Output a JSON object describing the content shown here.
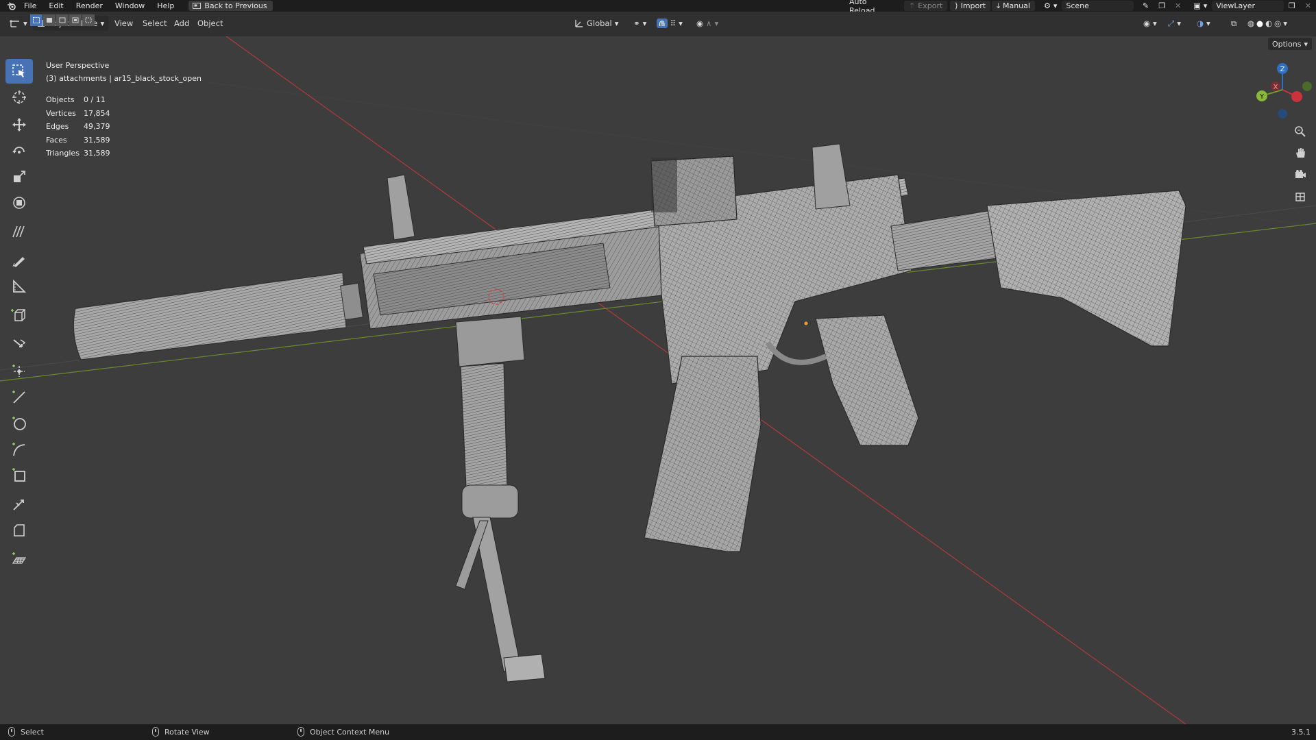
{
  "topbar": {
    "menu": [
      "File",
      "Edit",
      "Render",
      "Window",
      "Help"
    ],
    "back_label": "Back to Previous",
    "auto_reload": "Auto Reload",
    "export": "Export",
    "import": "Import",
    "manual": "Manual",
    "scene": "Scene",
    "view_layer": "ViewLayer"
  },
  "header": {
    "mode": "Object Mode",
    "menus": [
      "View",
      "Select",
      "Add",
      "Object"
    ],
    "orientation": "Global",
    "options": "Options"
  },
  "overlay": {
    "perspective": "User Perspective",
    "collection": "(3) attachments | ar15_black_stock_open"
  },
  "stats": [
    {
      "label": "Objects",
      "value": "0 / 11"
    },
    {
      "label": "Vertices",
      "value": "17,854"
    },
    {
      "label": "Edges",
      "value": "49,379"
    },
    {
      "label": "Faces",
      "value": "31,589"
    },
    {
      "label": "Triangles",
      "value": "31,589"
    }
  ],
  "gizmo": {
    "x": "X",
    "y": "Y",
    "z": "Z"
  },
  "statusbar": {
    "select": "Select",
    "rotate": "Rotate View",
    "context": "Object Context Menu",
    "version": "3.5.1"
  },
  "colors": {
    "accent": "#4772b3",
    "x_axis": "#c8343a",
    "y_axis": "#6a9a2a",
    "z_axis": "#2f6fbf"
  },
  "icons": [
    "blender-logo",
    "select-box-icon",
    "cursor-icon",
    "move-icon",
    "rotate-icon",
    "scale-icon",
    "transform-icon",
    "annotate-icon",
    "annotate-line-icon",
    "measure-icon",
    "add-cube-icon",
    "extrude-icon",
    "add-point-icon",
    "add-line-icon",
    "add-circle-icon",
    "add-curve-icon",
    "add-square-icon",
    "transform-point-icon",
    "note-icon",
    "grid-icon",
    "zoom-icon",
    "pan-hand-icon",
    "camera-icon",
    "ortho-grid-icon"
  ]
}
